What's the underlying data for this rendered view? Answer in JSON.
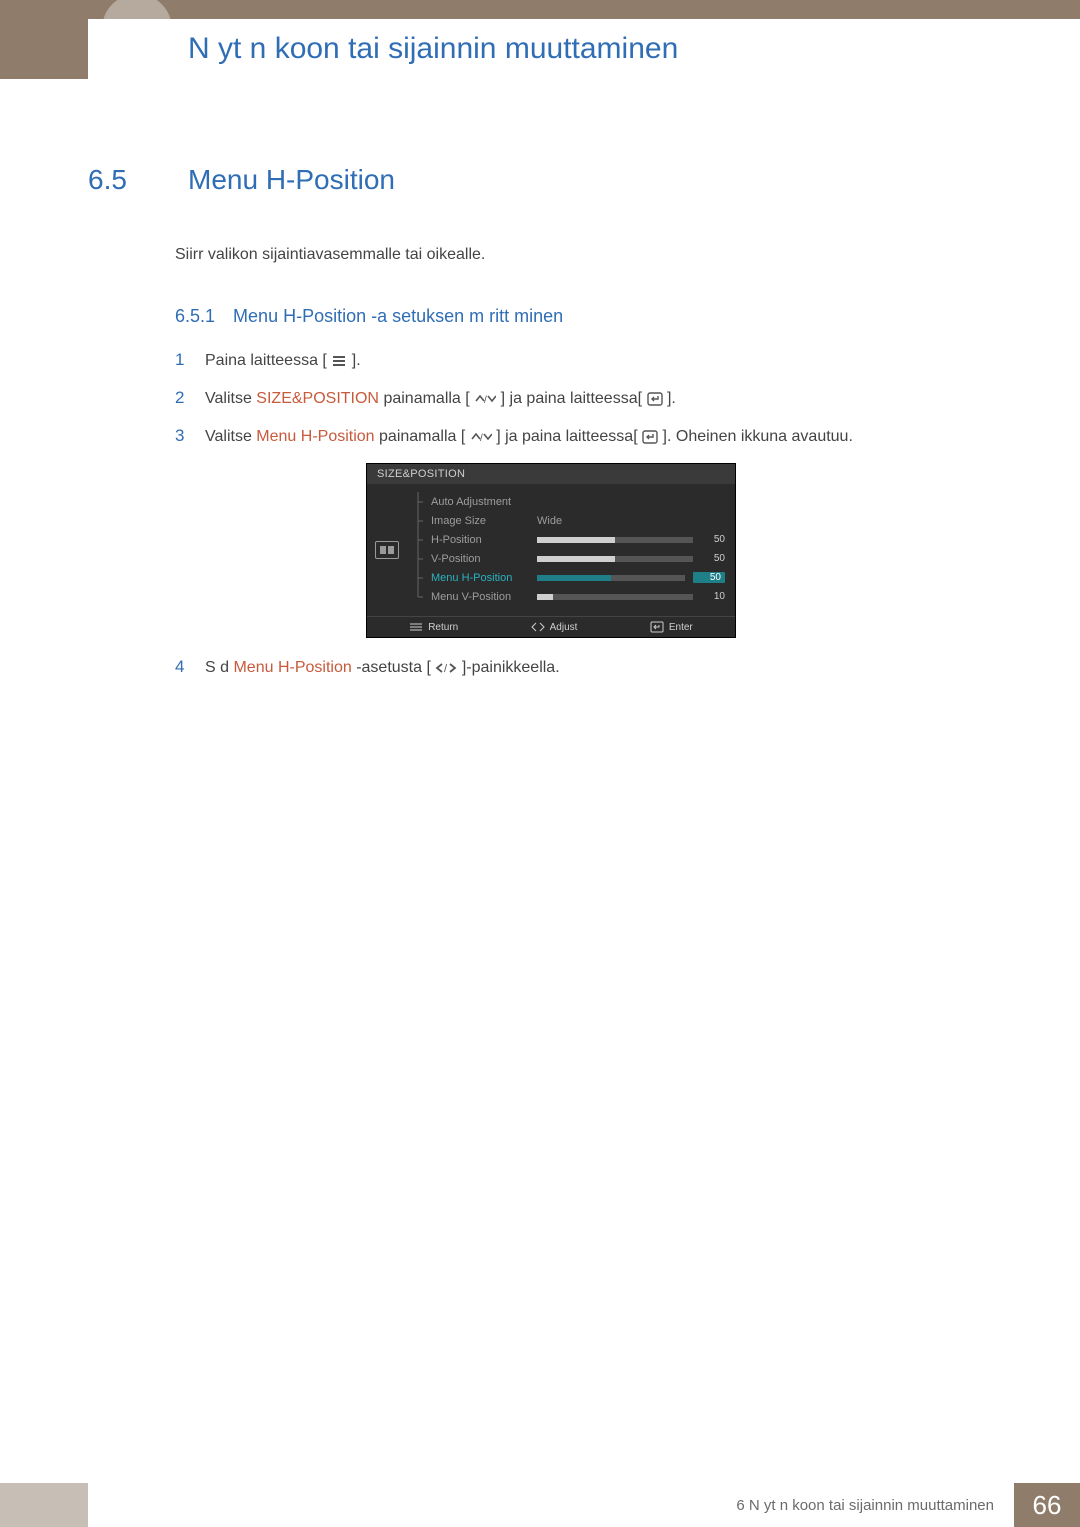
{
  "header": {
    "title": "N yt n koon tai sijainnin muuttaminen"
  },
  "section": {
    "num": "6.5",
    "title": "Menu H-Position",
    "intro": "Siirr  valikon sijaintiavasemmalle tai oikealle."
  },
  "subsection": {
    "num": "6.5.1",
    "title": "Menu H-Position -a setuksen m  ritt minen"
  },
  "steps": {
    "s1": {
      "num": "1",
      "a": "Paina laitteessa [",
      "b": "]."
    },
    "s2": {
      "num": "2",
      "a": "Valitse",
      "kw": "SIZE&POSITION",
      "b": "painamalla [",
      "c": "] ja paina laitteessa[",
      "d": "]."
    },
    "s3": {
      "num": "3",
      "a": "Valitse",
      "kw": "Menu H-Position",
      "b": "painamalla [",
      "c": "] ja paina laitteessa[",
      "d": "]. Oheinen ikkuna avautuu."
    },
    "s4": {
      "num": "4",
      "a": "S  d ",
      "kw": "Menu H-Position",
      "b": "   -asetusta [",
      "c": "]-painikkeella."
    }
  },
  "osd": {
    "title": "SIZE&POSITION",
    "rows": {
      "auto": "Auto Adjustment",
      "img": "Image Size",
      "imgval": "Wide",
      "hp": "H-Position",
      "vp": "V-Position",
      "mhp": "Menu H-Position",
      "mvp": "Menu V-Position"
    },
    "vals": {
      "hp": "50",
      "vp": "50",
      "mhp": "50",
      "mvp": "10"
    },
    "footer": {
      "ret": "Return",
      "adj": "Adjust",
      "ent": "Enter"
    }
  },
  "footer": {
    "text": "6 N yt n koon tai sijainnin muuttaminen",
    "page": "66"
  }
}
